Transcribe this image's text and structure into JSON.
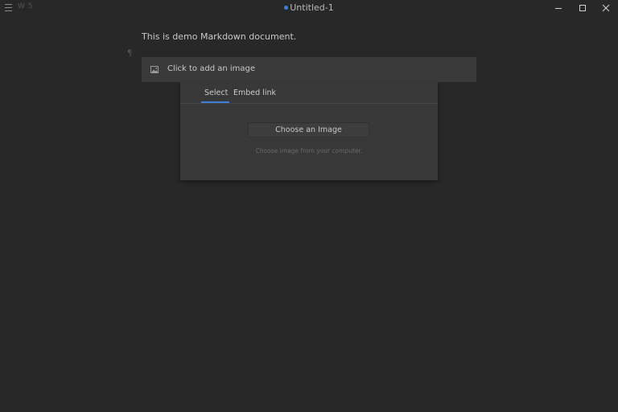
{
  "titlebar": {
    "word_count": "W 5",
    "title": "Untitled-1",
    "modified_color": "#3f7ed6"
  },
  "icons": {
    "menu": "hamburger-menu-icon",
    "minimize": "minimize-icon",
    "maximize": "maximize-icon",
    "close": "close-icon",
    "paragraph": "pilcrow-icon",
    "image": "image-icon"
  },
  "editor": {
    "paragraph_text": "This is demo Markdown document.",
    "pilcrow": "¶",
    "image_block_label": "Click to add an image"
  },
  "image_popup": {
    "tabs": [
      {
        "label": "Select",
        "active": true
      },
      {
        "label": "Embed link",
        "active": false
      }
    ],
    "choose_button_label": "Choose an Image",
    "hint": "Choose image from your computer."
  },
  "colors": {
    "background": "#282828",
    "accent": "#3f7ed6",
    "panel": "#383838",
    "image_block": "#3a3a3a"
  }
}
